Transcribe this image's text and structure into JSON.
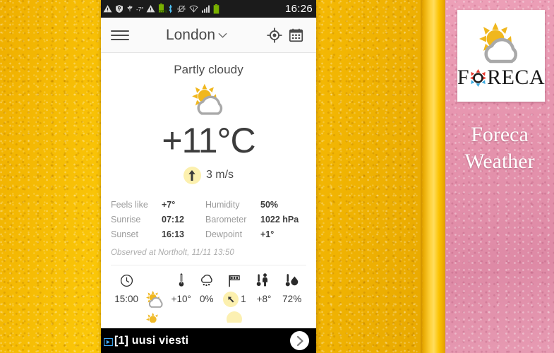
{
  "scene": {
    "left_wall_color": "#F9C10C",
    "right_wall_color": "#E794AE"
  },
  "poster": {
    "brand_letters": [
      "F",
      "O",
      "R",
      "E",
      "C",
      "A"
    ],
    "brand_text": "FORECA",
    "caption_line1": "Foreca",
    "caption_line2": "Weather",
    "sun_color": "#F0B71E",
    "cloud_color": "#A9A9A9",
    "o_top_color": "#E8392F",
    "o_bottom_color": "#3AA9E0"
  },
  "statusbar": {
    "icons": [
      "warning-triangle-icon",
      "shield-icon",
      "usb-icon",
      "temperature-text",
      "warning-triangle-icon",
      "battery-green-icon",
      "bluetooth-icon",
      "vibrate-mute-icon",
      "wifi-icon",
      "signal-bars-icon",
      "battery-icon"
    ],
    "cpu_temp": "-7°",
    "battery_percent": "100%",
    "clock": "16:26"
  },
  "appbar": {
    "menu_label": "menu",
    "city": "London",
    "chevron": "⌄",
    "locate_label": "locate",
    "calendar_label": "calendar"
  },
  "current": {
    "condition": "Partly cloudy",
    "temperature": "+11°C",
    "wind_speed": "3 m/s",
    "wind_direction_deg": 0
  },
  "details": {
    "rows": [
      {
        "key1": "Feels like",
        "val1": "+7°",
        "key2": "Humidity",
        "val2": "50%"
      },
      {
        "key1": "Sunrise",
        "val1": "07:12",
        "key2": "Barometer",
        "val2": "1022 hPa"
      },
      {
        "key1": "Sunset",
        "val1": "16:13",
        "key2": "Dewpoint",
        "val2": "+1°"
      }
    ],
    "observed": "Observed at Northolt, 11/11 13:50"
  },
  "forecast": {
    "header_icons": [
      "clock-icon",
      "weather-icon",
      "thermometer-icon",
      "precipitation-cloud-icon",
      "wind-flag-icon",
      "feels-like-icon",
      "humidity-icon"
    ],
    "rows": [
      {
        "time": "15:00",
        "icon": "partly-cloudy-icon",
        "temp": "+10°",
        "precip": "0%",
        "wind": "1",
        "wind_direction_deg": 225,
        "feels_like": "+8°",
        "humidity": "72%"
      }
    ]
  },
  "ad": {
    "choices_label": "AdChoices",
    "text": "[1] uusi viesti",
    "cta_label": "›"
  }
}
